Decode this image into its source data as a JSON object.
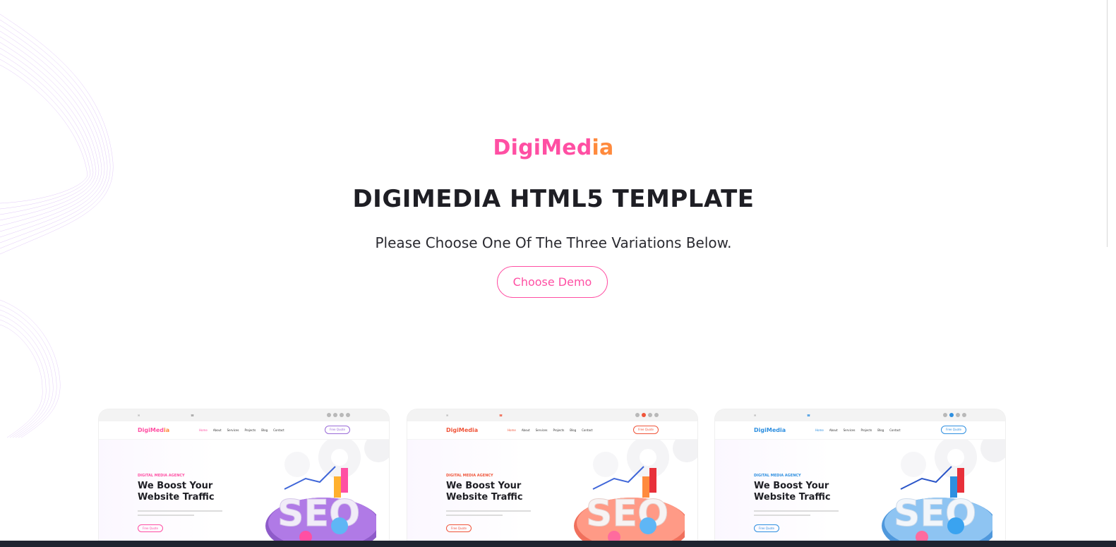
{
  "brand": {
    "logo_part1": "DigiMed",
    "logo_part2": "ia",
    "pink": "#ff4fa3",
    "orange": "#ff8a3d"
  },
  "hero": {
    "headline": "DIGIMEDIA HTML5 TEMPLATE",
    "subline": "Please Choose One Of The Three Variations Below.",
    "cta_label": "Choose Demo"
  },
  "previews": [
    {
      "theme_color": "#ff4fa3",
      "logo_part1": "DigiMed",
      "logo_part2": "ia",
      "menu": [
        "Home",
        "About",
        "Services",
        "Projects",
        "Blog",
        "Contact"
      ],
      "quote_label": "Free Quote",
      "tag": "DIGITAL MEDIA AGENCY",
      "title": "We Boost Your Website Traffic",
      "button_label": "Free Quote",
      "seo_text": "SEO"
    },
    {
      "theme_color": "#f0553a",
      "logo_part1": "DigiMedia",
      "logo_part2": "",
      "menu": [
        "Home",
        "About",
        "Services",
        "Projects",
        "Blog",
        "Contact"
      ],
      "quote_label": "Free Quote",
      "tag": "DIGITAL MEDIA AGENCY",
      "title": "We Boost Your Website Traffic",
      "button_label": "Free Quote",
      "seo_text": "SEO"
    },
    {
      "theme_color": "#2e8fe0",
      "logo_part1": "DigiMedia",
      "logo_part2": "",
      "menu": [
        "Home",
        "About",
        "Services",
        "Projects",
        "Blog",
        "Contact"
      ],
      "quote_label": "Free Quote",
      "tag": "DIGITAL MEDIA AGENCY",
      "title": "We Boost Your Website Traffic",
      "button_label": "Free Quote",
      "seo_text": "SEO"
    }
  ],
  "icons": {
    "decoration": "wave-lines-icon",
    "mail": "mail-icon",
    "phone": "phone-icon",
    "social": "social-dot-icon"
  }
}
